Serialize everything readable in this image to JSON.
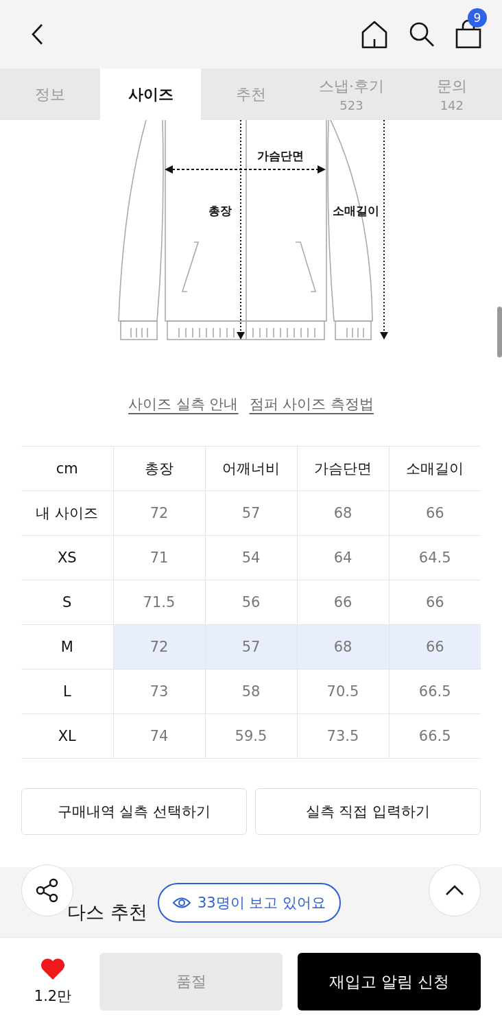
{
  "header": {
    "cart_count": "9"
  },
  "tabs": [
    {
      "label": "정보",
      "selected": false
    },
    {
      "label": "사이즈",
      "selected": true
    },
    {
      "label": "추천",
      "selected": false
    },
    {
      "label": "스냅·후기",
      "count": "523",
      "selected": false
    },
    {
      "label": "문의",
      "count": "142",
      "selected": false
    }
  ],
  "diagram": {
    "labels": {
      "chest": "가슴단면",
      "length": "총장",
      "sleeve": "소매길이"
    }
  },
  "links": [
    "사이즈 실측 안내",
    "점퍼 사이즈 측정법"
  ],
  "table": {
    "columns": [
      "cm",
      "총장",
      "어깨너비",
      "가슴단면",
      "소매길이"
    ],
    "rows": [
      {
        "cells": [
          "내 사이즈",
          "72",
          "57",
          "68",
          "66"
        ],
        "selected": false
      },
      {
        "cells": [
          "XS",
          "71",
          "54",
          "64",
          "64.5"
        ],
        "selected": false
      },
      {
        "cells": [
          "S",
          "71.5",
          "56",
          "66",
          "66"
        ],
        "selected": false
      },
      {
        "cells": [
          "M",
          "72",
          "57",
          "68",
          "66"
        ],
        "selected": true
      },
      {
        "cells": [
          "L",
          "73",
          "58",
          "70.5",
          "66.5"
        ],
        "selected": false
      },
      {
        "cells": [
          "XL",
          "74",
          "59.5",
          "73.5",
          "66.5"
        ],
        "selected": false
      }
    ]
  },
  "actions": [
    "구매내역 실측 선택하기",
    "실측 직접 입력하기"
  ],
  "recommend": {
    "title": "다스 추천"
  },
  "viewers": "33명이 보고 있어요",
  "bottom_bar": {
    "liked": true,
    "likes": "1.2만",
    "sold_out": "품절",
    "sold_out_disabled": true,
    "restock": "재입고 알림 신청"
  }
}
